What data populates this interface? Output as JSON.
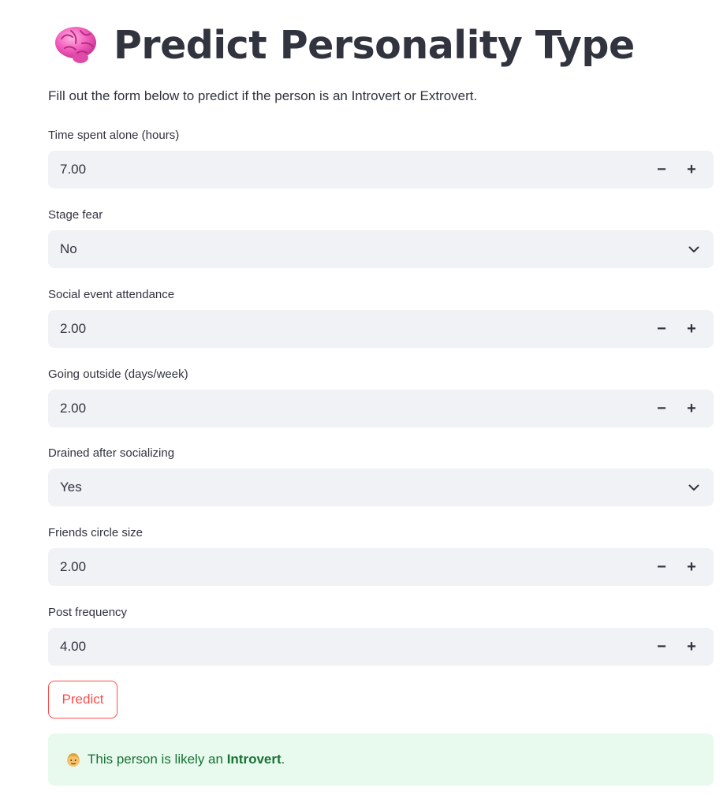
{
  "page": {
    "title": "Predict Personality Type",
    "title_icon": "brain-icon",
    "subtitle": "Fill out the form below to predict if the person is an Introvert or Extrovert."
  },
  "form": {
    "time_alone": {
      "label": "Time spent alone (hours)",
      "value": "7.00"
    },
    "stage_fear": {
      "label": "Stage fear",
      "value": "No"
    },
    "social_event": {
      "label": "Social event attendance",
      "value": "2.00"
    },
    "going_outside": {
      "label": "Going outside (days/week)",
      "value": "2.00"
    },
    "drained": {
      "label": "Drained after socializing",
      "value": "Yes"
    },
    "friends_circle": {
      "label": "Friends circle size",
      "value": "2.00"
    },
    "post_frequency": {
      "label": "Post frequency",
      "value": "4.00"
    },
    "stepper_minus": "−",
    "stepper_plus": "+"
  },
  "predict_button": {
    "label": "Predict"
  },
  "result": {
    "icon": "person-icon",
    "prefix": "This person is likely an ",
    "type": "Introvert",
    "suffix": "."
  },
  "colors": {
    "primary": "#ff4b4b",
    "input_bg": "#f0f2f6",
    "text": "#31333f",
    "success_bg": "#e8f9ee",
    "success_text": "#177233"
  }
}
